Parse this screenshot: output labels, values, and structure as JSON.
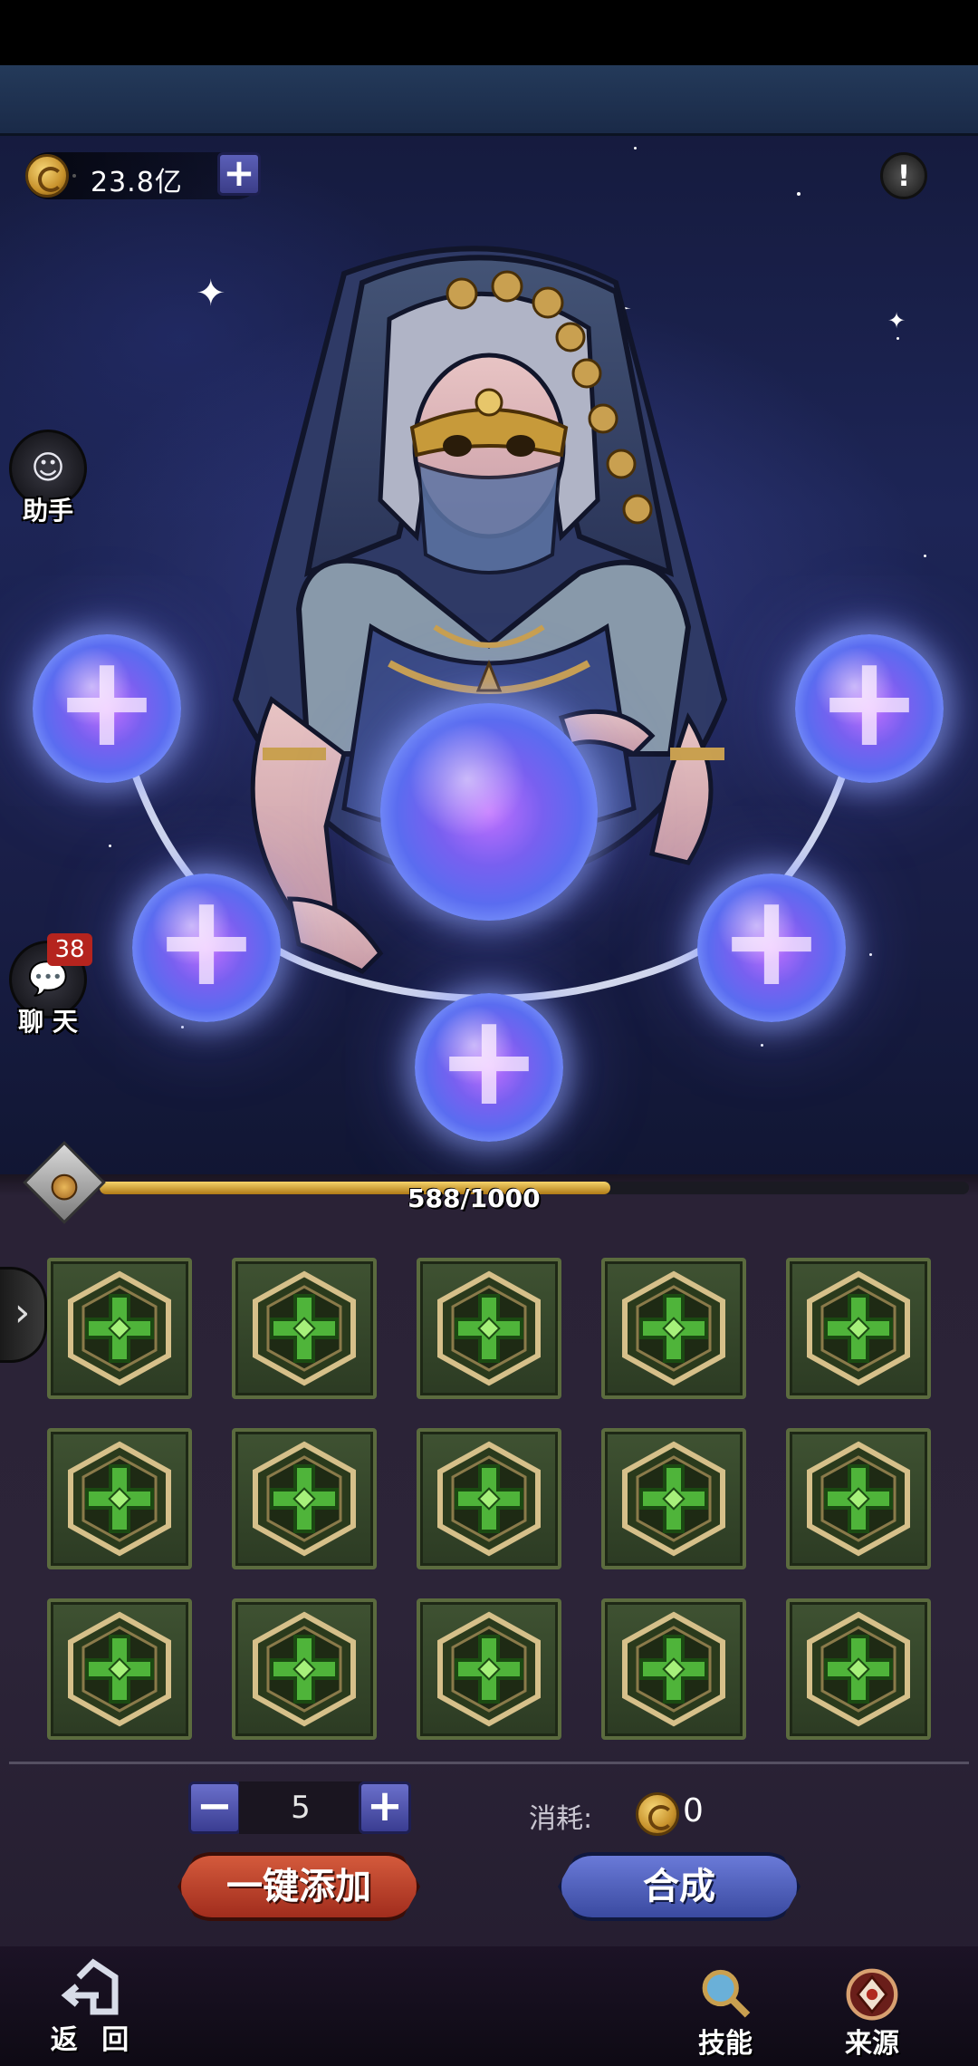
{
  "currency": {
    "amount": "23.8亿",
    "add_label": "+"
  },
  "info_label": "!",
  "side": {
    "assistant_label": "助手",
    "chat_label": "聊 天",
    "chat_badge": "38"
  },
  "progress": {
    "current": 588,
    "max": 1000,
    "text": "588/1000",
    "fraction": 0.588
  },
  "slots": {
    "rows": 3,
    "cols": 5,
    "count": 15,
    "icon": "green-cross-rune-icon"
  },
  "quantity": {
    "minus": "−",
    "value": "5",
    "plus": "+"
  },
  "cost": {
    "label": "消耗:",
    "value": "0"
  },
  "buttons": {
    "add_all": "一键添加",
    "combine": "合成"
  },
  "nav": {
    "back": "返 回",
    "skills": "技能",
    "source": "来源"
  },
  "orb_plus": "+",
  "colors": {
    "orb": "#7860f0",
    "slot_green": "#3f5232",
    "add_btn": "#c0432b",
    "combine_btn": "#4a5ab8"
  }
}
